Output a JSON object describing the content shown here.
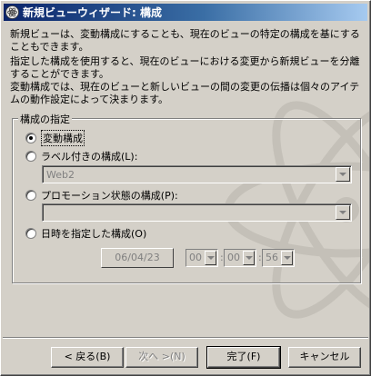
{
  "window": {
    "title": "新規ビューウィザード: 構成"
  },
  "description": {
    "line1": "新規ビューは、変動構成にすることも、現在のビューの特定の構成を基にすることもできます。",
    "line2": "指定した構成を使用すると、現在のビューにおける変更から新規ビューを分離することができます。",
    "line3": "変動構成では、現在のビューと新しいビューの間の変更の伝播は個々のアイテムの動作設定によって決まります。"
  },
  "config_group": {
    "legend": "構成の指定",
    "options": [
      {
        "label": "変動構成",
        "checked": true
      },
      {
        "label": "ラベル付きの構成(L):",
        "checked": false
      },
      {
        "label": "プロモーション状態の構成(P):",
        "checked": false
      },
      {
        "label": "日時を指定した構成(O)",
        "checked": false
      }
    ],
    "label_combo_value": "Web2",
    "promotion_combo_value": "",
    "date_value": "06/04/23",
    "hour_value": "00",
    "minute_value": "00",
    "second_value": "56"
  },
  "buttons": {
    "back": "< 戻る(B)",
    "next": "次へ >(N)",
    "finish": "完了(F)",
    "cancel": "キャンセル"
  },
  "colors": {
    "titlebar_start": "#0a246a",
    "titlebar_end": "#a6caf0",
    "face": "#d4d0c8"
  }
}
